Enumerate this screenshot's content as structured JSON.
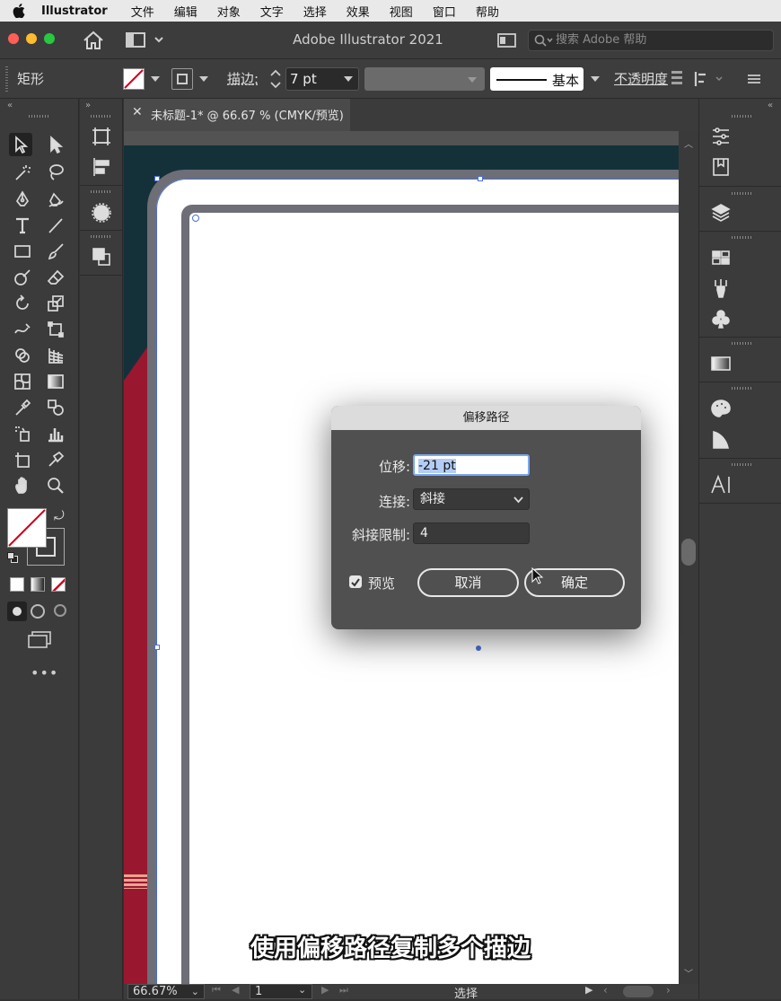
{
  "menubar": {
    "app_name": "Illustrator",
    "items": [
      "文件",
      "编辑",
      "对象",
      "文字",
      "选择",
      "效果",
      "视图",
      "窗口",
      "帮助"
    ]
  },
  "window": {
    "title": "Adobe Illustrator 2021",
    "search_placeholder": "搜索 Adobe 帮助"
  },
  "control_bar": {
    "object_type": "矩形",
    "stroke_label": "描边:",
    "stroke_value": "7 pt",
    "stroke_style": "基本",
    "opacity_label": "不透明度"
  },
  "document": {
    "tab_title": "未标题-1* @ 66.67 % (CMYK/预览)"
  },
  "dialog": {
    "title": "偏移路径",
    "offset_label": "位移:",
    "offset_value": "-21 pt",
    "joins_label": "连接:",
    "joins_value": "斜接",
    "miter_label": "斜接限制:",
    "miter_value": "4",
    "preview_label": "预览",
    "preview_checked": true,
    "cancel_label": "取消",
    "ok_label": "确定"
  },
  "status_bar": {
    "zoom": "66.67%",
    "page": "1",
    "tool": "选择"
  },
  "caption": "使用偏移路径复制多个描边",
  "colors": {
    "artboard_bg": "#14313a",
    "accent_red": "#9a1730",
    "frame_gray": "#6d6e76",
    "selection_blue": "#4a6fd8"
  }
}
